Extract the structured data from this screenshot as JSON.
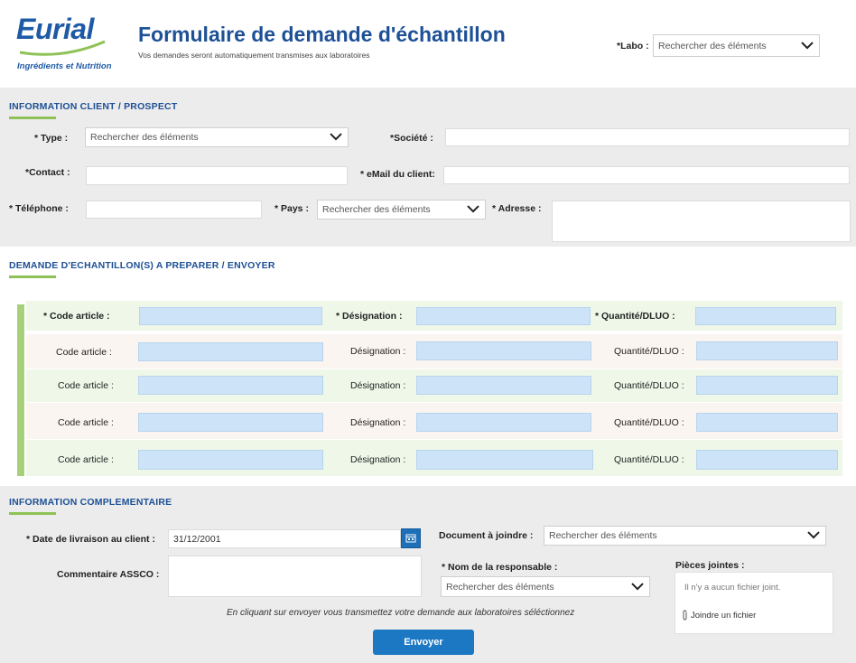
{
  "header": {
    "logo_text": "Eurial",
    "logo_subtitle": "Ingrédients et Nutrition",
    "title": "Formulaire de demande d'échantillon",
    "subtitle": "Vos demandes seront automatiquement transmises aux laboratoires",
    "labo_label": "*Labo :",
    "labo_placeholder": "Rechercher des éléments"
  },
  "client": {
    "section_title": "INFORMATION CLIENT / PROSPECT",
    "type_label": "* Type :",
    "type_placeholder": "Rechercher des éléments",
    "societe_label": "*Société :",
    "contact_label": "*Contact :",
    "email_label": "* eMail du client:",
    "telephone_label": "* Téléphone :",
    "pays_label": "* Pays :",
    "pays_placeholder": "Rechercher des éléments",
    "adresse_label": "* Adresse :"
  },
  "demande": {
    "section_title": "DEMANDE D'ECHANTILLON(S) A PREPARER / ENVOYER",
    "first_row": {
      "code_label": "* Code article :",
      "designation_label": "* Désignation :",
      "quantite_label": "* Quantité/DLUO :"
    },
    "rows": [
      {
        "code_label": "Code article :",
        "designation_label": "Désignation :",
        "quantite_label": "Quantité/DLUO :"
      },
      {
        "code_label": "Code article :",
        "designation_label": "Désignation :",
        "quantite_label": "Quantité/DLUO :"
      },
      {
        "code_label": "Code article :",
        "designation_label": "Désignation :",
        "quantite_label": "Quantité/DLUO :"
      },
      {
        "code_label": "Code article :",
        "designation_label": "Désignation :",
        "quantite_label": "Quantité/DLUO :"
      }
    ]
  },
  "info": {
    "section_title": "INFORMATION COMPLEMENTAIRE",
    "date_label": "* Date de livraison au client :",
    "date_value": "31/12/2001",
    "document_label": "Document à joindre :",
    "document_placeholder": "Rechercher des éléments",
    "commentaire_label": "Commentaire ASSCO :",
    "responsable_label": "* Nom de la responsable :",
    "responsable_placeholder": "Rechercher des éléments",
    "pieces_label": "Pièces jointes :",
    "no_file_text": "Il n'y a aucun fichier joint.",
    "attach_link": "Joindre un fichier",
    "note": "En cliquant sur envoyer vous transmettez votre demande aux laboratoires séléctionnez",
    "submit_label": "Envoyer"
  },
  "colors": {
    "brand_blue": "#1d5096",
    "accent_green": "#8ec256",
    "field_blue": "#cde3f7",
    "button_blue": "#1d78c4"
  }
}
